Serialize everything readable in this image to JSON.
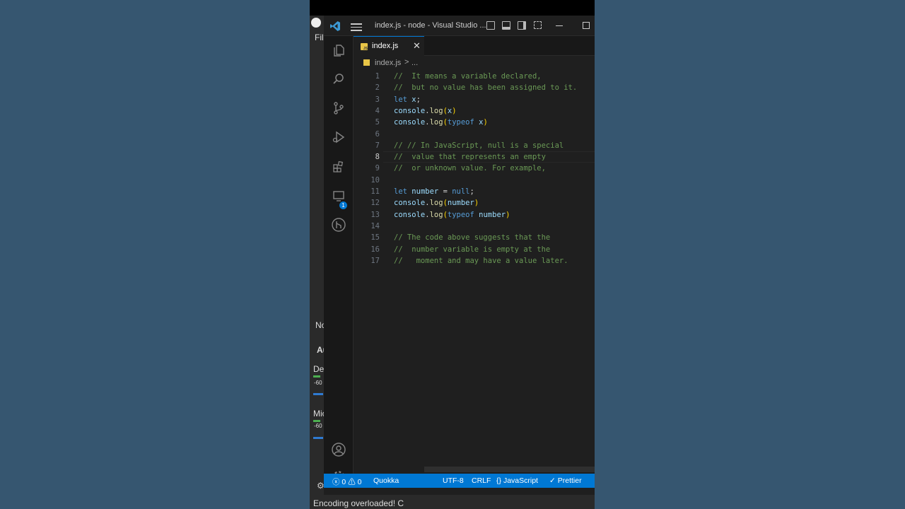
{
  "obs": {
    "menu_file": "File",
    "label_no": "No",
    "label_a": "Au",
    "label_desktop": "Desktop Audio",
    "label_db1": "-60",
    "label_mic": "Mic/Aux",
    "label_db2": "-60",
    "status": "Encoding overloaded! C"
  },
  "window": {
    "title": "index.js - node - Visual Studio ..."
  },
  "tab": {
    "label": "index.js"
  },
  "breadcrumb": {
    "file": "index.js",
    "separator": ">",
    "rest": "..."
  },
  "editor": {
    "active_line": 8,
    "lines": [
      {
        "n": "1",
        "t": "//  It means a variable declared,"
      },
      {
        "n": "2",
        "t": "//  but no value has been assigned to it."
      },
      {
        "n": "3",
        "t": "let x;"
      },
      {
        "n": "4",
        "t": "console.log(x)"
      },
      {
        "n": "5",
        "t": "console.log(typeof x)"
      },
      {
        "n": "6",
        "t": ""
      },
      {
        "n": "7",
        "t": "// // In JavaScript, null is a special"
      },
      {
        "n": "8",
        "t": "//  value that represents an empty"
      },
      {
        "n": "9",
        "t": "//  or unknown value. For example,"
      },
      {
        "n": "10",
        "t": ""
      },
      {
        "n": "11",
        "t": "let number = null;"
      },
      {
        "n": "12",
        "t": "console.log(number)"
      },
      {
        "n": "13",
        "t": "console.log(typeof number)"
      },
      {
        "n": "14",
        "t": ""
      },
      {
        "n": "15",
        "t": "// The code above suggests that the"
      },
      {
        "n": "16",
        "t": "//  number variable is empty at the"
      },
      {
        "n": "17",
        "t": "//   moment and may have a value later."
      }
    ]
  },
  "statusbar": {
    "errors": "0",
    "warnings": "0",
    "quokka": "Quokka",
    "encoding": "UTF-8",
    "eol": "CRLF",
    "language": "JavaScript",
    "formatter": "Prettier"
  },
  "extensions_badge": "1",
  "colors": {
    "accent": "#0078d4",
    "comment": "#6a9955",
    "keyword": "#569cd6",
    "variable": "#9cdcfe",
    "function": "#dcdcaa"
  }
}
